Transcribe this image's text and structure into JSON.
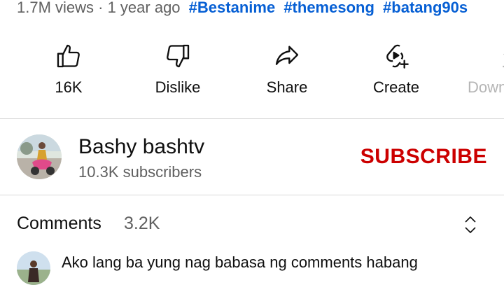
{
  "video_meta": {
    "views_time": "1.7M views · 1 year ago",
    "hashtags": [
      "#Bestanime",
      "#themesong",
      "#batang90s"
    ]
  },
  "actions": {
    "like": "16K",
    "dislike": "Dislike",
    "share": "Share",
    "create": "Create",
    "download": "Down"
  },
  "channel": {
    "name": "Bashy bashtv",
    "subscribers": "10.3K subscribers",
    "subscribe_label": "SUBSCRIBE"
  },
  "comments": {
    "title": "Comments",
    "count": "3.2K",
    "first_comment": "Ako lang ba yung nag babasa ng comments habang"
  },
  "colors": {
    "hashtag": "#065fd4",
    "subscribe": "#cc0000",
    "secondary_text": "#606060",
    "faded_text": "#b5b5b5"
  },
  "icons": [
    "thumbs-up-icon",
    "thumbs-down-icon",
    "share-icon",
    "create-icon",
    "download-icon",
    "expand-collapse-icon"
  ]
}
